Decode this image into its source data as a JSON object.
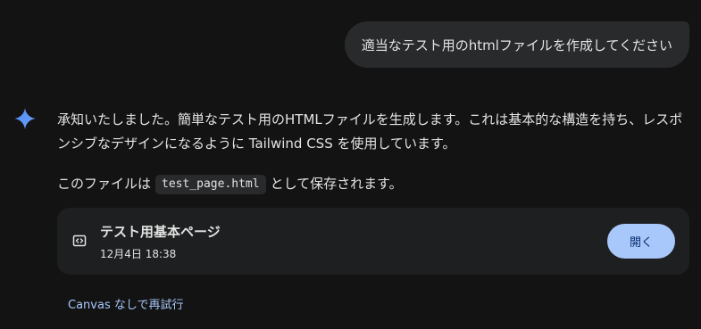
{
  "user_message": {
    "text": "適当なテスト用のhtmlファイルを作成してください"
  },
  "response": {
    "paragraph1": "承知いたしました。簡単なテスト用のHTMLファイルを生成します。これは基本的な構造を持ち、レスポンシブなデザインになるように Tailwind CSS を使用しています。",
    "paragraph2_prefix": "このファイルは",
    "paragraph2_code": "test_page.html",
    "paragraph2_suffix": "として保存されます。"
  },
  "file_card": {
    "icon": "code-file-icon",
    "title": "テスト用基本ページ",
    "date": "12月4日 18:38",
    "open_label": "開く"
  },
  "retry": {
    "label": "Canvas なしで再試行"
  },
  "colors": {
    "background": "#131314",
    "bubble": "#282a2c",
    "card": "#1e1f20",
    "accent": "#a8c7fa",
    "sparkle_blue": "#4e8ef7"
  }
}
